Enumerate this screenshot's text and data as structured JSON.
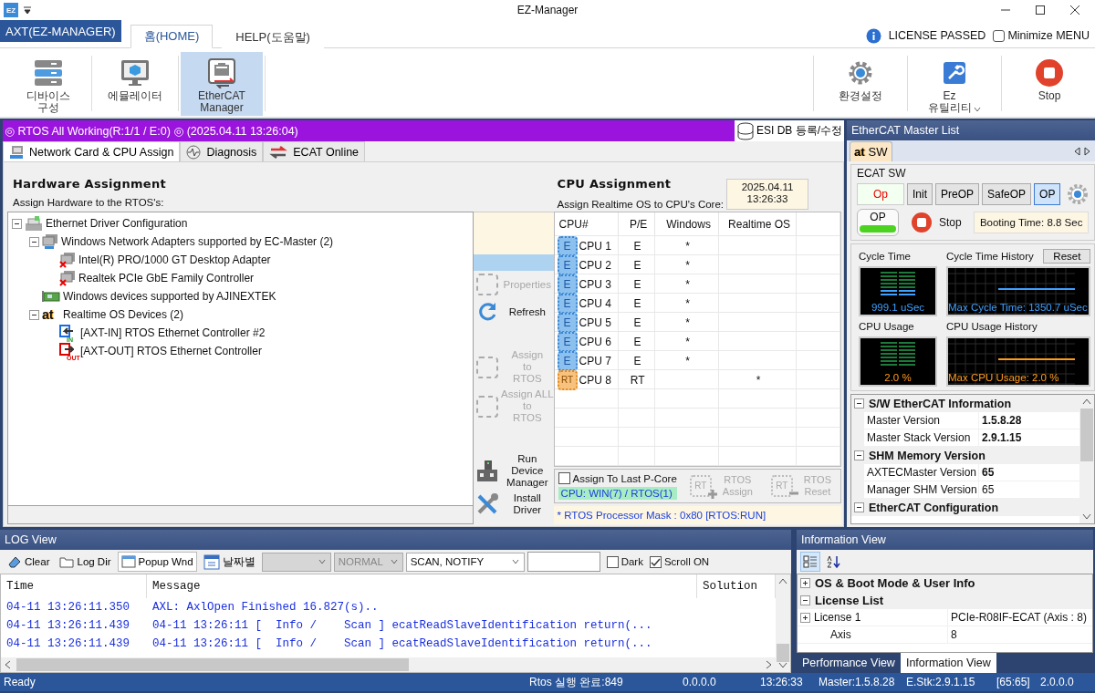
{
  "window": {
    "logo": "EZ",
    "title": "EZ-Manager"
  },
  "ribbon": {
    "app_button": "AXT(EZ-MANAGER)",
    "tabs": [
      {
        "label": "홈(HOME)",
        "selected": true
      },
      {
        "label": "HELP(도움말)",
        "selected": false
      }
    ],
    "license": {
      "label": "LICENSE PASSED"
    },
    "minimize_menu": {
      "label": "Minimize MENU",
      "checked": false
    },
    "left_buttons": [
      {
        "kind": "server",
        "label": "디바이스\n구성",
        "selected": false
      },
      {
        "kind": "emulator",
        "label": "에뮬레이터",
        "selected": false
      },
      {
        "kind": "ethercat",
        "label": "EtherCAT\nManager",
        "selected": true
      }
    ],
    "right_buttons": [
      {
        "kind": "gear",
        "label": "환경설정",
        "dropdown": false
      },
      {
        "kind": "wrench",
        "label": "Ez\n유틸리티",
        "dropdown": true
      },
      {
        "kind": "stop",
        "label": "Stop",
        "dropdown": false
      }
    ]
  },
  "status_banner": {
    "text": "◎ RTOS All Working(R:1/1 / E:0) ◎ (2025.04.11 13:26:04)"
  },
  "esi_button": {
    "label": "ESI DB 등록/수정"
  },
  "tabs": [
    {
      "kind": "network",
      "label": "Network Card & CPU Assign",
      "selected": true
    },
    {
      "kind": "pulse",
      "label": "Diagnosis",
      "selected": false
    },
    {
      "kind": "exchange",
      "label": "ECAT Online",
      "selected": false
    }
  ],
  "hardware": {
    "title": "Hardware Assignment",
    "subtitle": "Assign Hardware to the RTOS's:",
    "tree": [
      {
        "kind": "ethernet",
        "label": "Ethernet Driver Configuration",
        "expanded": true,
        "children": [
          {
            "kind": "computer",
            "label": "Windows Network Adapters supported by EC-Master (2)",
            "expanded": true,
            "children": [
              {
                "kind": "adapter",
                "label": "Intel(R) PRO/1000 GT Desktop Adapter"
              },
              {
                "kind": "adapter",
                "label": "Realtek PCIe GbE Family Controller"
              }
            ]
          },
          {
            "kind": "card",
            "label": "Windows devices supported by AJINEXTEK"
          },
          {
            "kind": "logo",
            "badge": "at",
            "label": "Realtime OS Devices (2)",
            "expanded": true,
            "children": [
              {
                "kind": "port-in",
                "badge": "IN",
                "label": "[AXT-IN] RTOS Ethernet Controller #2"
              },
              {
                "kind": "port-out",
                "badge": "OUT",
                "label": "[AXT-OUT] RTOS Ethernet Controller"
              }
            ]
          }
        ]
      }
    ]
  },
  "actions": [
    {
      "kind": "placeholder",
      "label": "Properties",
      "disabled": true
    },
    {
      "kind": "refresh",
      "label": "Refresh",
      "disabled": false
    },
    {
      "kind": "placeholder",
      "label": "Assign\nto\nRTOS",
      "disabled": true
    },
    {
      "kind": "placeholder",
      "label": "Assign ALL\nto\nRTOS",
      "disabled": true
    },
    {
      "kind": "device",
      "label": "Run Device\nManager",
      "disabled": false
    },
    {
      "kind": "tools",
      "label": "Install Driver",
      "disabled": false
    }
  ],
  "cpu": {
    "title": "CPU Assignment",
    "subtitle": "Assign Realtime OS to CPU's Core:",
    "timestamp": "2025.04.11\n13:26:33",
    "columns": [
      "CPU#",
      "P/E",
      "Windows",
      "Realtime OS"
    ],
    "rows": [
      {
        "kind": "e",
        "chip": "E",
        "cpu": "CPU 1",
        "pe": "E",
        "windows": "*"
      },
      {
        "kind": "e",
        "chip": "E",
        "cpu": "CPU 2",
        "pe": "E",
        "windows": "*"
      },
      {
        "kind": "e",
        "chip": "E",
        "cpu": "CPU 3",
        "pe": "E",
        "windows": "*"
      },
      {
        "kind": "e",
        "chip": "E",
        "cpu": "CPU 4",
        "pe": "E",
        "windows": "*"
      },
      {
        "kind": "e",
        "chip": "E",
        "cpu": "CPU 5",
        "pe": "E",
        "windows": "*"
      },
      {
        "kind": "e",
        "chip": "E",
        "cpu": "CPU 6",
        "pe": "E",
        "windows": "*"
      },
      {
        "kind": "e",
        "chip": "E",
        "cpu": "CPU 7",
        "pe": "E",
        "windows": "*"
      },
      {
        "kind": "rt",
        "chip": "RT",
        "cpu": "CPU 8",
        "pe": "RT",
        "rtos": "*"
      }
    ],
    "last_pcore": {
      "label": "Assign To Last P-Core",
      "checked": false
    },
    "summary": "CPU: WIN(7) / RTOS(1)",
    "buttons": [
      {
        "chip": "RT",
        "kind": "assign",
        "label": "RTOS\nAssign",
        "disabled": true
      },
      {
        "chip": "RT",
        "kind": "reset",
        "label": "RTOS\nReset",
        "disabled": true
      }
    ],
    "mask": "* RTOS Processor Mask : 0x80 [RTOS:RUN]"
  },
  "master_list": {
    "title": "EtherCAT Master List",
    "tabs": [
      {
        "badge": "at",
        "label": "SW",
        "selected": true
      }
    ],
    "group": {
      "title": "ECAT SW",
      "state": {
        "label": "Op"
      },
      "states": [
        {
          "label": "Init",
          "selected": false
        },
        {
          "label": "PreOP",
          "selected": false
        },
        {
          "label": "SafeOP",
          "selected": false
        },
        {
          "label": "OP",
          "selected": true
        }
      ],
      "indicator": {
        "label": "OP",
        "on": true
      },
      "stop": {
        "label": "Stop"
      },
      "booting": "Booting Time: 8.8 Sec"
    },
    "monitors": [
      {
        "title": "Cycle Time",
        "reading": "999.1 uSec",
        "color": "#3ea0ff",
        "history_title": "Cycle Time History",
        "history_reading": "Max Cycle Time: 1350.7 uSec",
        "reset": "Reset"
      },
      {
        "title": "CPU Usage",
        "reading": "2.0 %",
        "color": "#ff9a1a",
        "history_title": "CPU Usage History",
        "history_reading": "Max CPU Usage: 2.0 %"
      }
    ],
    "properties": [
      {
        "title": "S/W EtherCAT Information",
        "expanded": true,
        "rows": [
          {
            "name": "Master Version",
            "value": "1.5.8.28",
            "bold": true
          },
          {
            "name": "Master Stack Version",
            "value": "2.9.1.15",
            "bold": true
          }
        ]
      },
      {
        "title": "SHM Memory Version",
        "expanded": true,
        "rows": [
          {
            "name": "AXTECMaster Version",
            "value": "65",
            "bold": true
          },
          {
            "name": "Manager SHM Version",
            "value": "65",
            "bold": false
          }
        ]
      },
      {
        "title": "EtherCAT Configuration",
        "expanded": true
      }
    ]
  },
  "log": {
    "title": "LOG View",
    "toolbar": [
      {
        "kind": "eraser",
        "label": "Clear",
        "pressed": false
      },
      {
        "kind": "folder",
        "label": "Log Dir",
        "pressed": false
      },
      {
        "kind": "window",
        "label": "Popup Wnd",
        "pressed": true
      },
      {
        "kind": "calendar",
        "label": "날짜별",
        "pressed": false
      }
    ],
    "filters": [
      {
        "disabled": true
      },
      {
        "value": "NORMAL",
        "disabled": true
      },
      {
        "value": "SCAN, NOTIFY",
        "disabled": false
      }
    ],
    "options": [
      {
        "label": "Dark",
        "checked": false
      },
      {
        "label": "Scroll ON",
        "checked": true
      }
    ],
    "columns": [
      "Time",
      "Message",
      "Solution"
    ],
    "rows": [
      {
        "time": "04-11 13:26:11.350",
        "message": "AXL: AxlOpen Finished 16.827(s).."
      },
      {
        "time": "04-11 13:26:11.439",
        "message": "04-11 13:26:11 [  Info /    Scan ] ecatReadSlaveIdentification return(..."
      },
      {
        "time": "04-11 13:26:11.439",
        "message": "04-11 13:26:11 [  Info /    Scan ] ecatReadSlaveIdentification return(..."
      }
    ]
  },
  "info": {
    "title": "Information View",
    "toolbar": [
      {
        "kind": "categorized",
        "selected": true
      },
      {
        "kind": "alphabetical",
        "selected": false
      }
    ],
    "sections": [
      {
        "title": "OS & Boot Mode & User Info",
        "expanded": false
      },
      {
        "title": "License List",
        "expanded": true,
        "rows": [
          {
            "name": "License 1",
            "value": "PCIe-R08IF-ECAT (Axis : 8)",
            "expanded": false
          },
          {
            "name": "Axis",
            "value": "8"
          }
        ]
      }
    ],
    "tabs": [
      {
        "label": "Performance View",
        "selected": false
      },
      {
        "label": "Information View",
        "selected": true
      }
    ]
  },
  "status_bar": [
    "Ready",
    "Rtos 실행 완료:849",
    "0.0.0.0",
    "13:26:33",
    "Master:1.5.8.28",
    "E.Stk:2.9.1.15",
    "[65:65]",
    "2.0.0.0"
  ]
}
